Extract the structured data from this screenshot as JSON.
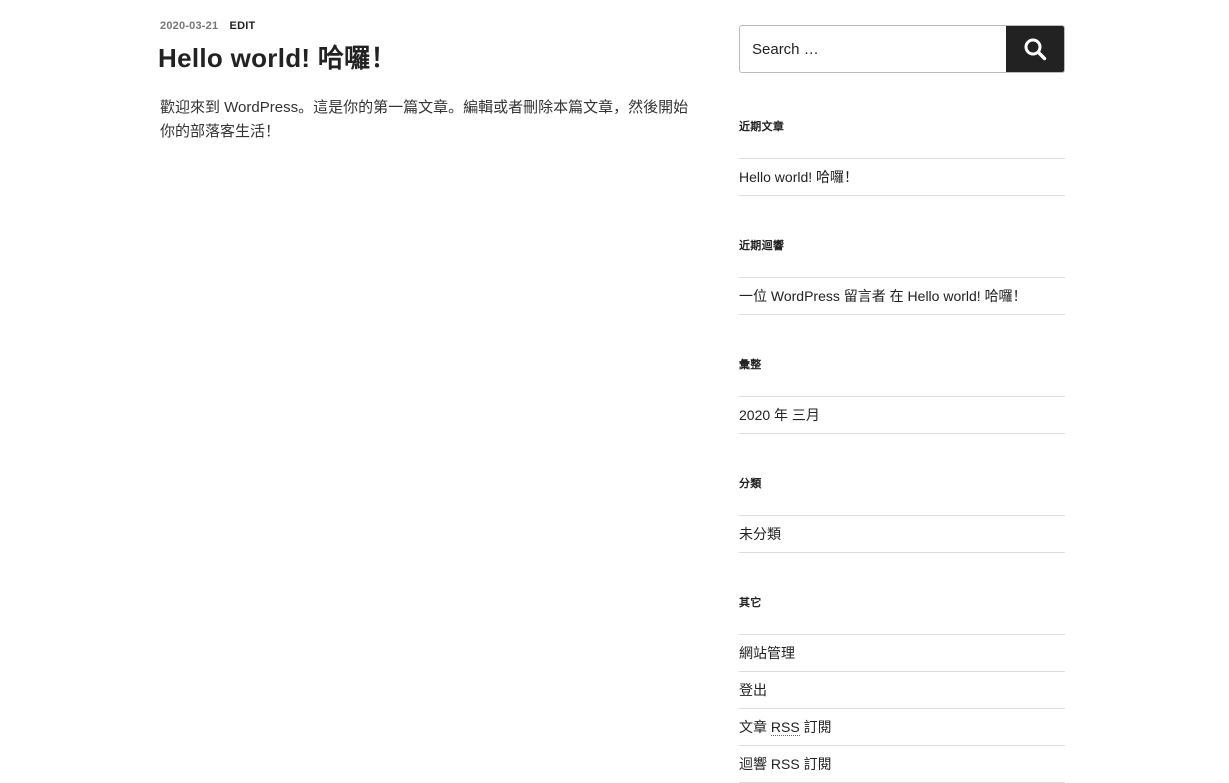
{
  "post": {
    "date": "2020-03-21",
    "edit_label": "EDIT",
    "title": "Hello world! 哈囉！",
    "content": "歡迎來到 WordPress。這是你的第一篇文章。編輯或者刪除本篇文章，然後開始你的部落客生活！"
  },
  "search": {
    "placeholder": "Search …",
    "button_label": "Search"
  },
  "widgets": {
    "recent_posts": {
      "title": "近期文章",
      "items": [
        "Hello world! 哈囉！"
      ]
    },
    "recent_comments": {
      "title": "近期迴響",
      "author": "一位 WordPress 留言者",
      "connector": "在",
      "post": "Hello world! 哈囉！"
    },
    "archives": {
      "title": "彙整",
      "items": [
        "2020 年 三月"
      ]
    },
    "categories": {
      "title": "分類",
      "items": [
        "未分類"
      ]
    },
    "meta": {
      "title": "其它",
      "site_admin": "網站管理",
      "logout": "登出",
      "entries_prefix": "文章",
      "entries_rss": "RSS",
      "entries_suffix": "訂閱",
      "comments_prefix": "迴響",
      "comments_rss": "RSS",
      "comments_suffix": "訂閱"
    }
  },
  "colors": {
    "accent": "#222222",
    "meta_gray": "#767676",
    "divider": "#dddddd"
  }
}
